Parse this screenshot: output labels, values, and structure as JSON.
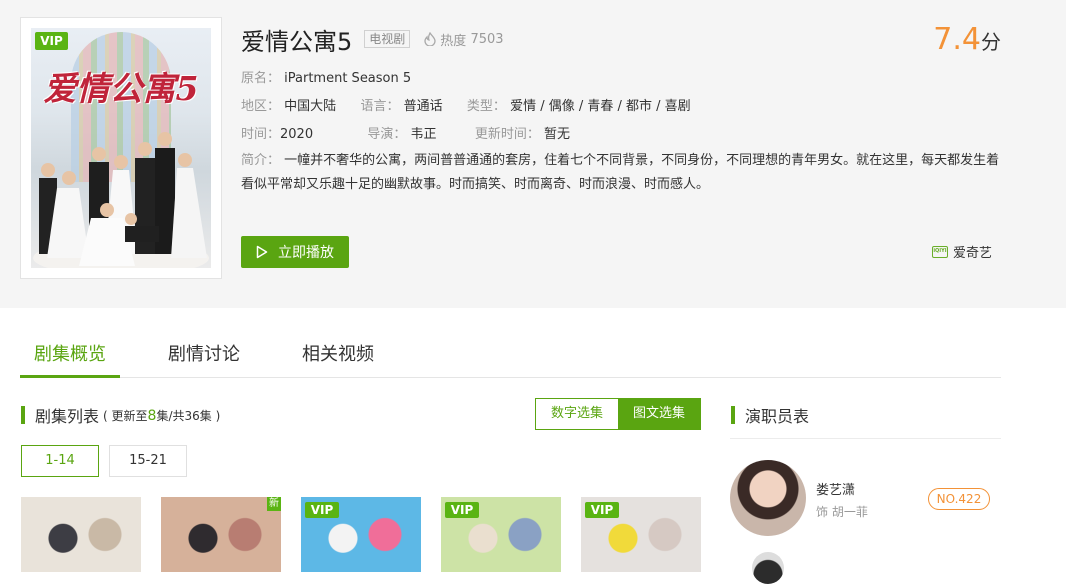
{
  "show": {
    "title": "爱情公寓5",
    "type_tag": "电视剧",
    "heat_label": "热度",
    "heat_value": "7503",
    "score": "7.4",
    "score_unit": "分",
    "vip_badge": "VIP",
    "poster_title": "爱情公寓5",
    "original_name_label": "原名：",
    "original_name": "iPartment Season 5",
    "region_label": "地区：",
    "region": "中国大陆",
    "language_label": "语言：",
    "language": "普通话",
    "genre_label": "类型：",
    "genre": "爱情 / 偶像 / 青春 / 都市 / 喜剧",
    "time_label": "时间：",
    "time": "2020",
    "director_label": "导演：",
    "director": "韦正",
    "update_label": "更新时间：",
    "update": "暂无",
    "desc_label": "简介：",
    "description": "一幢并不奢华的公寓，两间普普通通的套房，住着七个不同背景，不同身份，不同理想的青年男女。就在这里，每天都发生着看似平常却又乐趣十足的幽默故事。时而搞笑、时而离奇、时而浪漫、时而感人。"
  },
  "actions": {
    "play_label": "立即播放",
    "source_label": "爱奇艺",
    "source_logo_text": "iQIYI"
  },
  "tabs": [
    {
      "label": "剧集概览",
      "active": true
    },
    {
      "label": "剧情讨论",
      "active": false
    },
    {
      "label": "相关视频",
      "active": false
    }
  ],
  "episodes": {
    "title": "剧集列表",
    "sub_prefix": "( 更新至",
    "updated_to": "8",
    "sub_suffix": "集/共36集 )",
    "view_numeric": "数字选集",
    "view_image": "图文选集",
    "ranges": [
      "1-14",
      "15-21"
    ],
    "thumbs": [
      {
        "vip": "",
        "new": "",
        "colors": [
          "#e9e3da",
          "#3d3d44",
          "#c9b9a6"
        ]
      },
      {
        "vip": "",
        "new": "新",
        "colors": [
          "#d6b19a",
          "#2f2b2f",
          "#b87d72"
        ]
      },
      {
        "vip": "VIP",
        "new": "",
        "colors": [
          "#5db8e6",
          "#f3f3f3",
          "#f06e99"
        ]
      },
      {
        "vip": "VIP",
        "new": "",
        "colors": [
          "#cde3a6",
          "#eadfcf",
          "#8aa1c4"
        ]
      },
      {
        "vip": "VIP",
        "new": "",
        "colors": [
          "#e5e1de",
          "#f1da3a",
          "#d6c9c3"
        ]
      }
    ]
  },
  "cast": {
    "title": "演职员表",
    "members": [
      {
        "name": "娄艺潇",
        "role": "饰  胡一菲",
        "rank": "NO.422"
      }
    ]
  },
  "colors": {
    "accent": "#5aa511",
    "score": "#f39237",
    "hero_bg": "#f5f5f5"
  }
}
